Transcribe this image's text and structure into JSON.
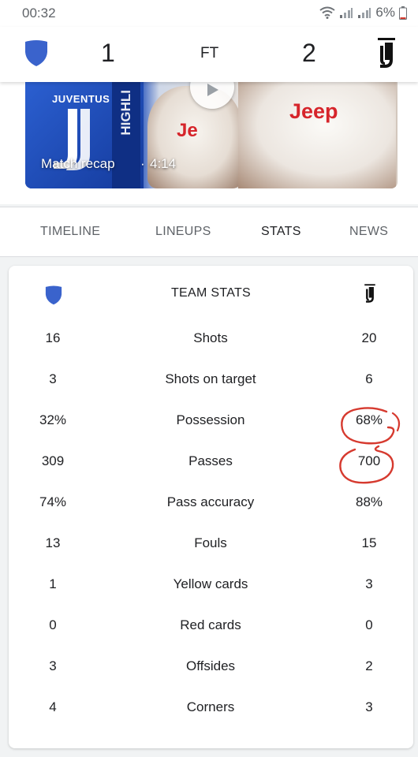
{
  "status_bar": {
    "time": "00:32",
    "battery": "6%"
  },
  "match": {
    "home_score": "1",
    "status": "FT",
    "away_score": "2"
  },
  "video": {
    "brand_text": "JUVENTUS",
    "side_text": "HIGHLI",
    "sponsor_text": "Jeep",
    "sponsor_partial": "Je",
    "label": "Match recap",
    "separator": "·",
    "duration": "4:14"
  },
  "tabs": [
    {
      "label": "TIMELINE",
      "active": false
    },
    {
      "label": "LINEUPS",
      "active": false
    },
    {
      "label": "STATS",
      "active": true
    },
    {
      "label": "NEWS",
      "active": false
    }
  ],
  "team_stats": {
    "title": "TEAM STATS",
    "rows": [
      {
        "home": "16",
        "label": "Shots",
        "away": "20"
      },
      {
        "home": "3",
        "label": "Shots on target",
        "away": "6"
      },
      {
        "home": "32%",
        "label": "Possession",
        "away": "68%"
      },
      {
        "home": "309",
        "label": "Passes",
        "away": "700"
      },
      {
        "home": "74%",
        "label": "Pass accuracy",
        "away": "88%"
      },
      {
        "home": "13",
        "label": "Fouls",
        "away": "15"
      },
      {
        "home": "1",
        "label": "Yellow cards",
        "away": "3"
      },
      {
        "home": "0",
        "label": "Red cards",
        "away": "0"
      },
      {
        "home": "3",
        "label": "Offsides",
        "away": "2"
      },
      {
        "home": "4",
        "label": "Corners",
        "away": "3"
      }
    ]
  },
  "colors": {
    "home_shield": "#3a63cc",
    "annotation": "#d63a2f",
    "active_tab": "#202124",
    "inactive_tab": "#5f6368"
  },
  "icons": {
    "home_team": "shield-icon",
    "away_team": "juventus-logo-icon",
    "play": "play-icon"
  }
}
